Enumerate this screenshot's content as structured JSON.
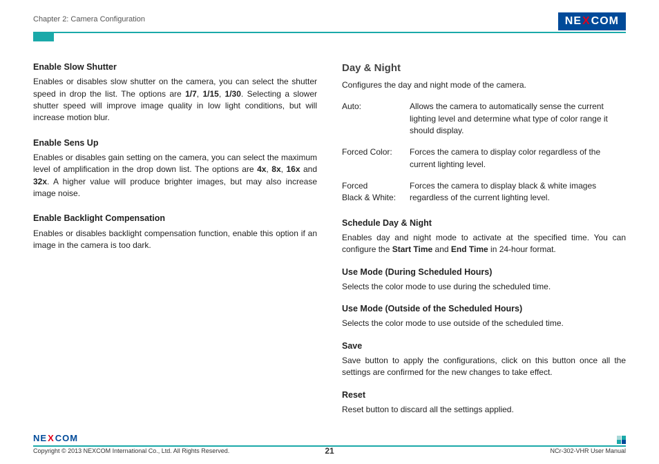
{
  "header": {
    "chapter": "Chapter 2: Camera Configuration",
    "logo_ne": "NE",
    "logo_x": "X",
    "logo_com": "COM"
  },
  "left": {
    "s1_h": "Enable Slow Shutter",
    "s1_p1": "Enables or disables slow shutter on the camera, you can select the shutter speed in drop the list. The options are ",
    "s1_b1": "1/7",
    "s1_c1": ", ",
    "s1_b2": "1/15",
    "s1_c2": ", ",
    "s1_b3": "1/30",
    "s1_p2": ". Selecting a slower shutter speed will improve image quality in low light conditions, but will increase motion blur.",
    "s2_h": "Enable Sens Up",
    "s2_p1": "Enables or disables gain setting on the camera, you can select the maximum level of amplification in the drop down list. The options are ",
    "s2_b1": "4x",
    "s2_c1": ", ",
    "s2_b2": "8x",
    "s2_c2": ", ",
    "s2_b3": "16x",
    "s2_c3": " and ",
    "s2_b4": "32x",
    "s2_p2": ". A higher value will produce brighter images, but may also increase image noise.",
    "s3_h": "Enable Backlight Compensation",
    "s3_p": "Enables or disables backlight compensation function, enable this option if an image in the camera is too dark."
  },
  "right": {
    "title": "Day & Night",
    "intro": "Configures the day and night mode of the camera.",
    "def1_t": "Auto:",
    "def1_d": "Allows the camera to automatically sense the current lighting level and determine what type of color range it should display.",
    "def2_t": "Forced Color:",
    "def2_d": "Forces the camera to display color regardless of the current lighting level.",
    "def3_t1": "Forced",
    "def3_t2": "Black & White:",
    "def3_d": "Forces the camera to display black & white images regardless of the current lighting level.",
    "s1_h": "Schedule Day & Night",
    "s1_p1": "Enables day and night mode to activate at the specified time. You can configure the ",
    "s1_b1": "Start Time",
    "s1_c1": " and ",
    "s1_b2": "End Time",
    "s1_p2": " in 24-hour format.",
    "s2_h": "Use Mode (During Scheduled Hours)",
    "s2_p": "Selects the color mode to use during the scheduled time.",
    "s3_h": "Use Mode (Outside of the Scheduled Hours)",
    "s3_p": "Selects the color mode to use outside of the scheduled time.",
    "s4_h": "Save",
    "s4_p": "Save button to apply the configurations, click on this button once all the settings are confirmed for the new changes to take effect.",
    "s5_h": "Reset",
    "s5_p": "Reset button to discard all the settings applied."
  },
  "footer": {
    "copyright": "Copyright © 2013 NEXCOM International Co., Ltd. All Rights Reserved.",
    "page": "21",
    "manual": "NCr-302-VHR User Manual"
  }
}
